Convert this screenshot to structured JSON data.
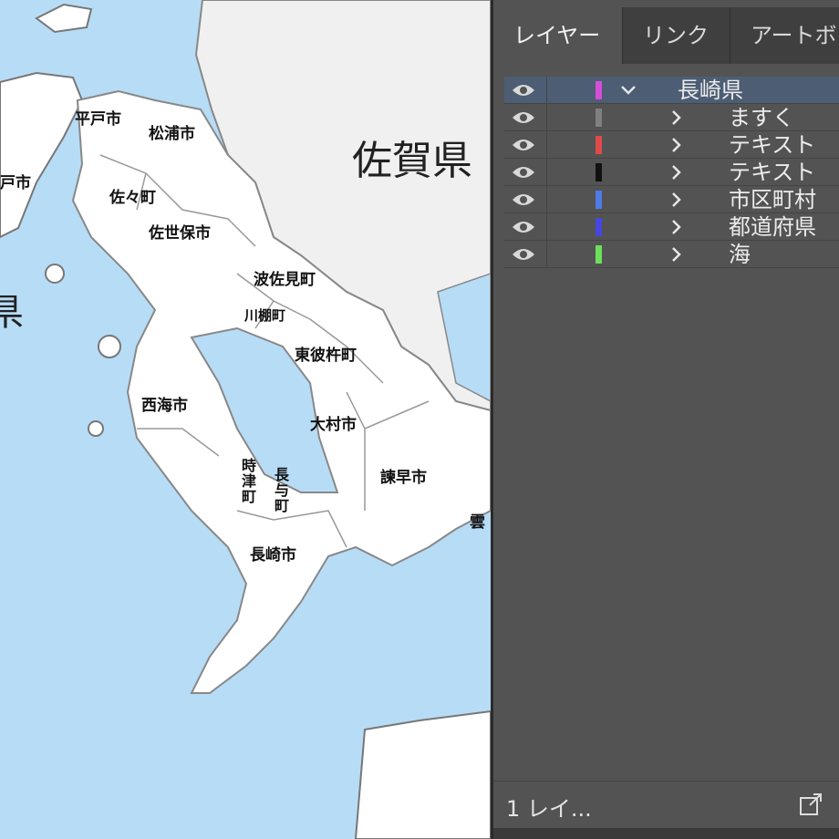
{
  "map": {
    "prefecture_label": "佐賀県",
    "partial_left_label": "戸市",
    "partial_left_big": "県",
    "partial_right_label": "雲",
    "municipalities": [
      "平戸市",
      "松浦市",
      "佐々町",
      "佐世保市",
      "波佐見町",
      "川棚町",
      "東彼杵町",
      "西海市",
      "大村市",
      "諫早市",
      "時津町",
      "長与町",
      "長崎市"
    ],
    "colors": {
      "sea": "#b7dcf6",
      "land": "#ffffff",
      "neighbor_land": "#f0f0f0",
      "border": "#888888"
    }
  },
  "panel": {
    "tabs": [
      {
        "label": "レイヤー",
        "active": true
      },
      {
        "label": "リンク",
        "active": false
      },
      {
        "label": "アートボ",
        "active": false
      }
    ],
    "layers": [
      {
        "name": "長崎県",
        "color": "#d54ed9",
        "expanded": true,
        "selected": true,
        "visible": true
      },
      {
        "name": "ますく",
        "color": "#808080",
        "expanded": false,
        "selected": false,
        "visible": true
      },
      {
        "name": "テキスト",
        "color": "#e04a4a",
        "expanded": false,
        "selected": false,
        "visible": true
      },
      {
        "name": "テキスト",
        "color": "#111111",
        "expanded": false,
        "selected": false,
        "visible": true
      },
      {
        "name": "市区町村",
        "color": "#4f7be8",
        "expanded": false,
        "selected": false,
        "visible": true
      },
      {
        "name": "都道府県",
        "color": "#4646e0",
        "expanded": false,
        "selected": false,
        "visible": true
      },
      {
        "name": "海",
        "color": "#6de05a",
        "expanded": false,
        "selected": false,
        "visible": true
      }
    ],
    "footer": {
      "layer_count": "1 レイ..."
    },
    "icons": {
      "visibility": "eye-icon",
      "expand": "chevron-right-icon",
      "collapse": "chevron-down-icon",
      "export": "export-icon"
    }
  }
}
